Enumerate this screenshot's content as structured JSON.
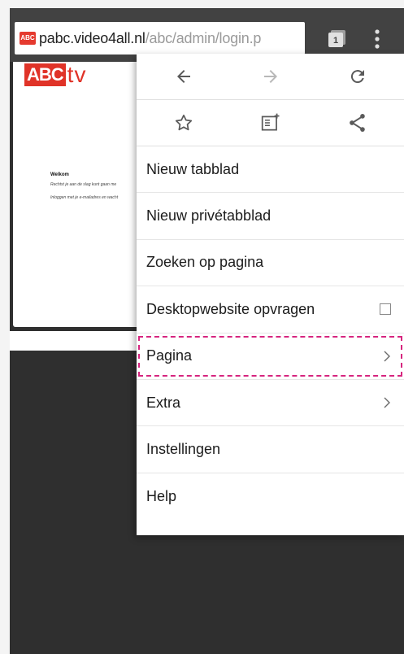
{
  "browser": {
    "url_host": "pabc.video4all.nl",
    "url_path": "/abc/admin/login.p",
    "url_scheme_prefix": "",
    "favicon_text": "ABC",
    "tab_count": "1"
  },
  "page": {
    "logo_abc": "ABC",
    "logo_tv": "tv",
    "welcome": "Welkom",
    "line1": "Rechtst je aan de slag kunt gaan me",
    "line2": "Inloggen met je e-mailadres en wacht"
  },
  "menu": {
    "icons": [
      "back-arrow-icon",
      "forward-arrow-icon",
      "refresh-icon",
      "bookmark-star-icon",
      "reading-list-add-icon",
      "share-icon"
    ],
    "items": [
      {
        "label": "Nieuw tabblad"
      },
      {
        "label": "Nieuw privétabblad"
      },
      {
        "label": "Zoeken op pagina"
      },
      {
        "label": "Desktopwebsite opvragen"
      },
      {
        "label": "Pagina"
      },
      {
        "label": "Extra"
      },
      {
        "label": "Instellingen"
      },
      {
        "label": "Help"
      }
    ]
  },
  "colors": {
    "toolbar": "#424242",
    "brand_red": "#e03328",
    "highlight": "#d6257f"
  }
}
